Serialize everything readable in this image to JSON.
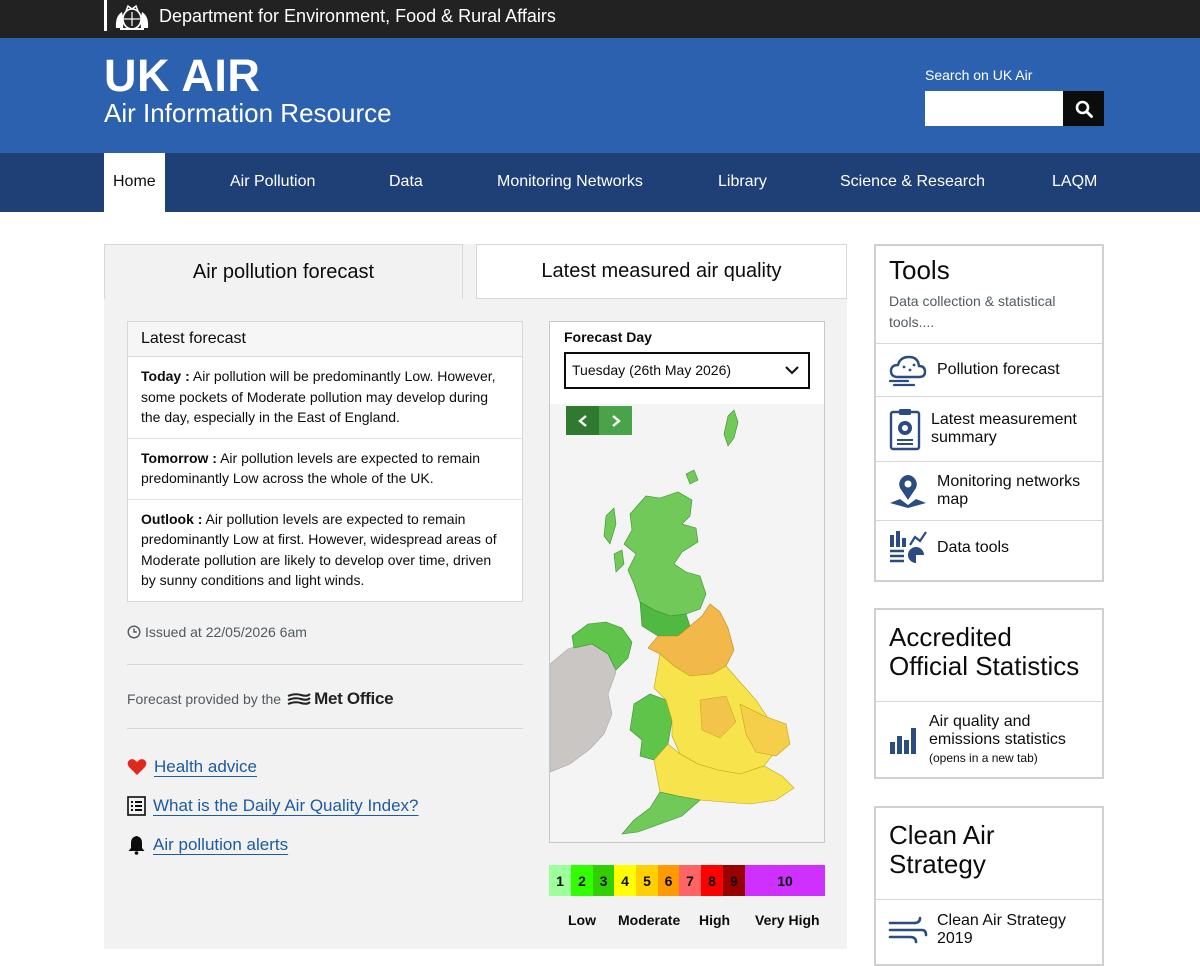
{
  "govbar": {
    "department": "Department for Environment, Food & Rural Affairs"
  },
  "header": {
    "title": "UK AIR",
    "subtitle": "Air Information Resource",
    "search_label": "Search on UK Air",
    "search_value": ""
  },
  "nav": {
    "items": [
      "Home",
      "Air Pollution",
      "Data",
      "Monitoring Networks",
      "Library",
      "Science & Research",
      "LAQM"
    ],
    "active": "Home"
  },
  "tabs": {
    "forecast": "Air pollution forecast",
    "measured": "Latest measured air quality"
  },
  "forecast": {
    "heading": "Latest forecast",
    "today_label": "Today :",
    "today_text": " Air pollution will be predominantly Low. However, some pockets of Moderate pollution may develop during the day, especially in the East of England.",
    "tomorrow_label": "Tomorrow :",
    "tomorrow_text": " Air pollution levels are expected to remain predominantly Low across the whole of the UK.",
    "outlook_label": "Outlook :",
    "outlook_text": " Air pollution levels are expected to remain predominantly Low at first. However, widespread areas of Moderate pollution are likely to develop over time, driven by sunny conditions and light winds.",
    "issued": "Issued at 22/05/2026 6am",
    "provided_by": "Forecast provided by the",
    "provider": "Met Office"
  },
  "links": {
    "health": "Health advice",
    "daqi": "What is the Daily Air Quality Index?",
    "alerts": "Air pollution alerts"
  },
  "map": {
    "day_label": "Forecast Day",
    "day_value": "Tuesday (26th May 2026)"
  },
  "daqi_scale": {
    "levels": [
      "1",
      "2",
      "3",
      "4",
      "5",
      "6",
      "7",
      "8",
      "9",
      "10"
    ],
    "colors": [
      "#9cff9c",
      "#31ff00",
      "#31cf00",
      "#ffff00",
      "#ffcf00",
      "#ff9a00",
      "#ff6464",
      "#ff0000",
      "#990000",
      "#ce30ff"
    ],
    "bands": [
      "Low",
      "Moderate",
      "High",
      "Very High"
    ]
  },
  "tools": {
    "title": "Tools",
    "subtitle": "Data collection & statistical tools....",
    "items": [
      "Pollution forecast",
      "Latest measurement summary",
      "Monitoring networks map",
      "Data tools"
    ]
  },
  "stats": {
    "title": "Accredited Official Statistics",
    "item": "Air quality and emissions statistics",
    "note": "(opens in a new tab)"
  },
  "strategy": {
    "title": "Clean Air Strategy",
    "item": "Clean Air Strategy 2019"
  }
}
